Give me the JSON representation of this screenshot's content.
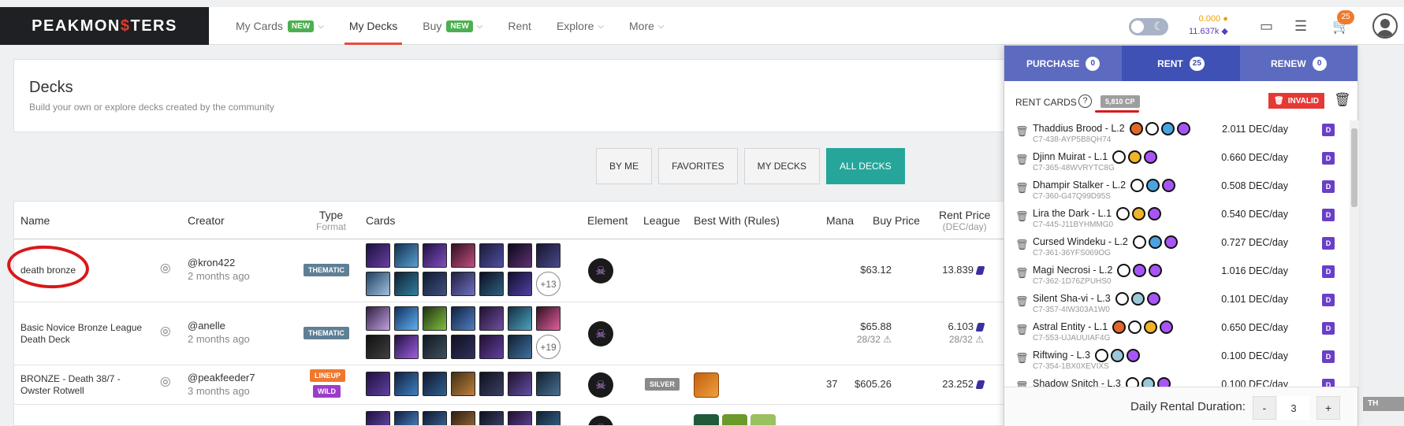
{
  "brand": {
    "logo_text_a": "PEAKMON",
    "logo_text_b": "$",
    "logo_text_c": "TERS"
  },
  "nav": {
    "items": [
      {
        "label": "My Cards",
        "badge": "NEW",
        "chevron": true
      },
      {
        "label": "My Decks",
        "active": true
      },
      {
        "label": "Buy",
        "badge": "NEW",
        "chevron": true
      },
      {
        "label": "Rent"
      },
      {
        "label": "Explore",
        "chevron": true
      },
      {
        "label": "More",
        "chevron": true
      }
    ]
  },
  "account": {
    "balance_top": "0.000",
    "balance_bottom": "11.637k",
    "cart_count": "25"
  },
  "header": {
    "title": "Decks",
    "subtitle": "Build your own or explore decks created by the community"
  },
  "filters": [
    "BY ME",
    "FAVORITES",
    "MY DECKS",
    "ALL DECKS"
  ],
  "table": {
    "columns": {
      "name": "Name",
      "creator": "Creator",
      "type": "Type",
      "type_sub": "Format",
      "cards": "Cards",
      "element": "Element",
      "league": "League",
      "best_with": "Best With (Rules)",
      "mana": "Mana",
      "buy_price": "Buy Price",
      "rent_price": "Rent Price",
      "rent_price_sub": "(DEC/day)"
    },
    "rows": [
      {
        "name": "death bronze",
        "creator": "@kron422",
        "when": "2 months ago",
        "type_tag": "THEMATIC",
        "more_cards": "+13",
        "buy_price": "$63.12",
        "rent_price": "13.839"
      },
      {
        "name": "Basic Novice Bronze League Death Deck",
        "creator": "@anelle",
        "when": "2 months ago",
        "type_tag": "THEMATIC",
        "more_cards": "+19",
        "buy_price": "$65.88",
        "buy_sub": "28/32",
        "rent_price": "6.103",
        "rent_sub": "28/32"
      },
      {
        "name": "BRONZE - Death 38/7 - Owster Rotwell",
        "creator": "@peakfeeder7",
        "when": "3 months ago",
        "type_tag": "LINEUP",
        "type_tag2": "WILD",
        "league": "SILVER",
        "mana": "37",
        "buy_price": "$605.26",
        "rent_price": "23.252"
      }
    ]
  },
  "cart_panel": {
    "tabs": [
      {
        "label": "PURCHASE",
        "count": "0"
      },
      {
        "label": "RENT",
        "count": "25",
        "active": true
      },
      {
        "label": "RENEW",
        "count": "0"
      }
    ],
    "rent_cards_label": "RENT CARDS",
    "cp_badge": "5,810 CP",
    "invalid_label": "INVALID",
    "items": [
      {
        "name": "Thaddius Brood - L.2",
        "uid": "C7-438-AYP5B8QH74",
        "price": "2.011 DEC/day",
        "icons": [
          "#e0682a",
          "#ffffff",
          "#4aa3df",
          "#a855f7"
        ]
      },
      {
        "name": "Djinn Muirat - L.1",
        "uid": "C7-365-48WVRYTC8G",
        "price": "0.660 DEC/day",
        "icons": [
          "#ffffff",
          "#f0b429",
          "#a855f7"
        ]
      },
      {
        "name": "Dhampir Stalker - L.2",
        "uid": "C7-360-G47Q99D95S",
        "price": "0.508 DEC/day",
        "icons": [
          "#ffffff",
          "#4aa3df",
          "#a855f7"
        ]
      },
      {
        "name": "Lira the Dark - L.1",
        "uid": "C7-445-J11BYHMMG0",
        "price": "0.540 DEC/day",
        "icons": [
          "#ffffff",
          "#f0b429",
          "#a855f7"
        ]
      },
      {
        "name": "Cursed Windeku - L.2",
        "uid": "C7-361-36YFS069OG",
        "price": "0.727 DEC/day",
        "icons": [
          "#ffffff",
          "#4aa3df",
          "#a855f7"
        ]
      },
      {
        "name": "Magi Necrosi - L.2",
        "uid": "C7-362-1D76ZPUHS0",
        "price": "1.016 DEC/day",
        "icons": [
          "#ffffff",
          "#a855f7",
          "#a855f7"
        ]
      },
      {
        "name": "Silent Sha-vi - L.3",
        "uid": "C7-357-4IW303A1W0",
        "price": "0.101 DEC/day",
        "icons": [
          "#ffffff",
          "#9ac7d9",
          "#a855f7"
        ]
      },
      {
        "name": "Astral Entity - L.1",
        "uid": "C7-553-UJAUUIAF4G",
        "price": "0.650 DEC/day",
        "icons": [
          "#e0682a",
          "#ffffff",
          "#f0b429",
          "#a855f7"
        ]
      },
      {
        "name": "Riftwing - L.3",
        "uid": "C7-354-1BX0XEVIXS",
        "price": "0.100 DEC/day",
        "icons": [
          "#ffffff",
          "#9ac7d9",
          "#a855f7"
        ]
      },
      {
        "name": "Shadow Snitch - L.3",
        "uid": "",
        "price": "0.100 DEC/day",
        "icons": [
          "#ffffff",
          "#9ac7d9",
          "#a855f7"
        ]
      }
    ],
    "duration_label": "Daily Rental Duration:",
    "duration_value": "3",
    "minus": "-",
    "plus": "+",
    "d_label": "D"
  },
  "edge_tab_label": "TH",
  "icons": {
    "share": "share-icon",
    "trash": "trash-icon",
    "help": "question-icon",
    "cart": "cart-icon",
    "inbox": "inbox-icon",
    "layers": "layers-icon",
    "theme": "moon-icon"
  }
}
